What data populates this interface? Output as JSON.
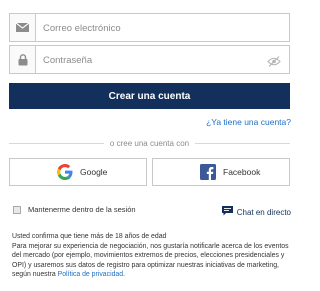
{
  "form": {
    "email_placeholder": "Correo electrónico",
    "password_placeholder": "Contraseña"
  },
  "actions": {
    "create_account": "Crear una cuenta",
    "have_account_link": "¿Ya tiene una cuenta?"
  },
  "divider": {
    "text": "o cree una cuenta con"
  },
  "social": {
    "google_label": "Google",
    "facebook_label": "Facebook"
  },
  "options": {
    "remember_label": "Mantenerme dentro de la sesión",
    "chat_label": "Chat en directo"
  },
  "legal": {
    "age_confirm": "Usted confirma que tiene más de 18 años de edad",
    "marketing_text": "Para mejorar su experiencia de negociación, nos gustaría notificarle acerca de los eventos del mercado (por ejemplo, movimientos extremos de precios, elecciones presidenciales y OPI) y usaremos sus datos de registro para optimizar nuestras iniciativas de marketing, según nuestra",
    "privacy_link": "Política de privacidad",
    "end_punct": "."
  },
  "colors": {
    "primary": "#13305c",
    "link": "#1f6fc5",
    "facebook": "#3b5998"
  },
  "icons": {
    "email": "envelope-icon",
    "password": "lock-icon",
    "visibility": "eye-slash-icon",
    "google": "google-icon",
    "facebook": "facebook-icon",
    "chat": "chat-bubble-icon"
  }
}
